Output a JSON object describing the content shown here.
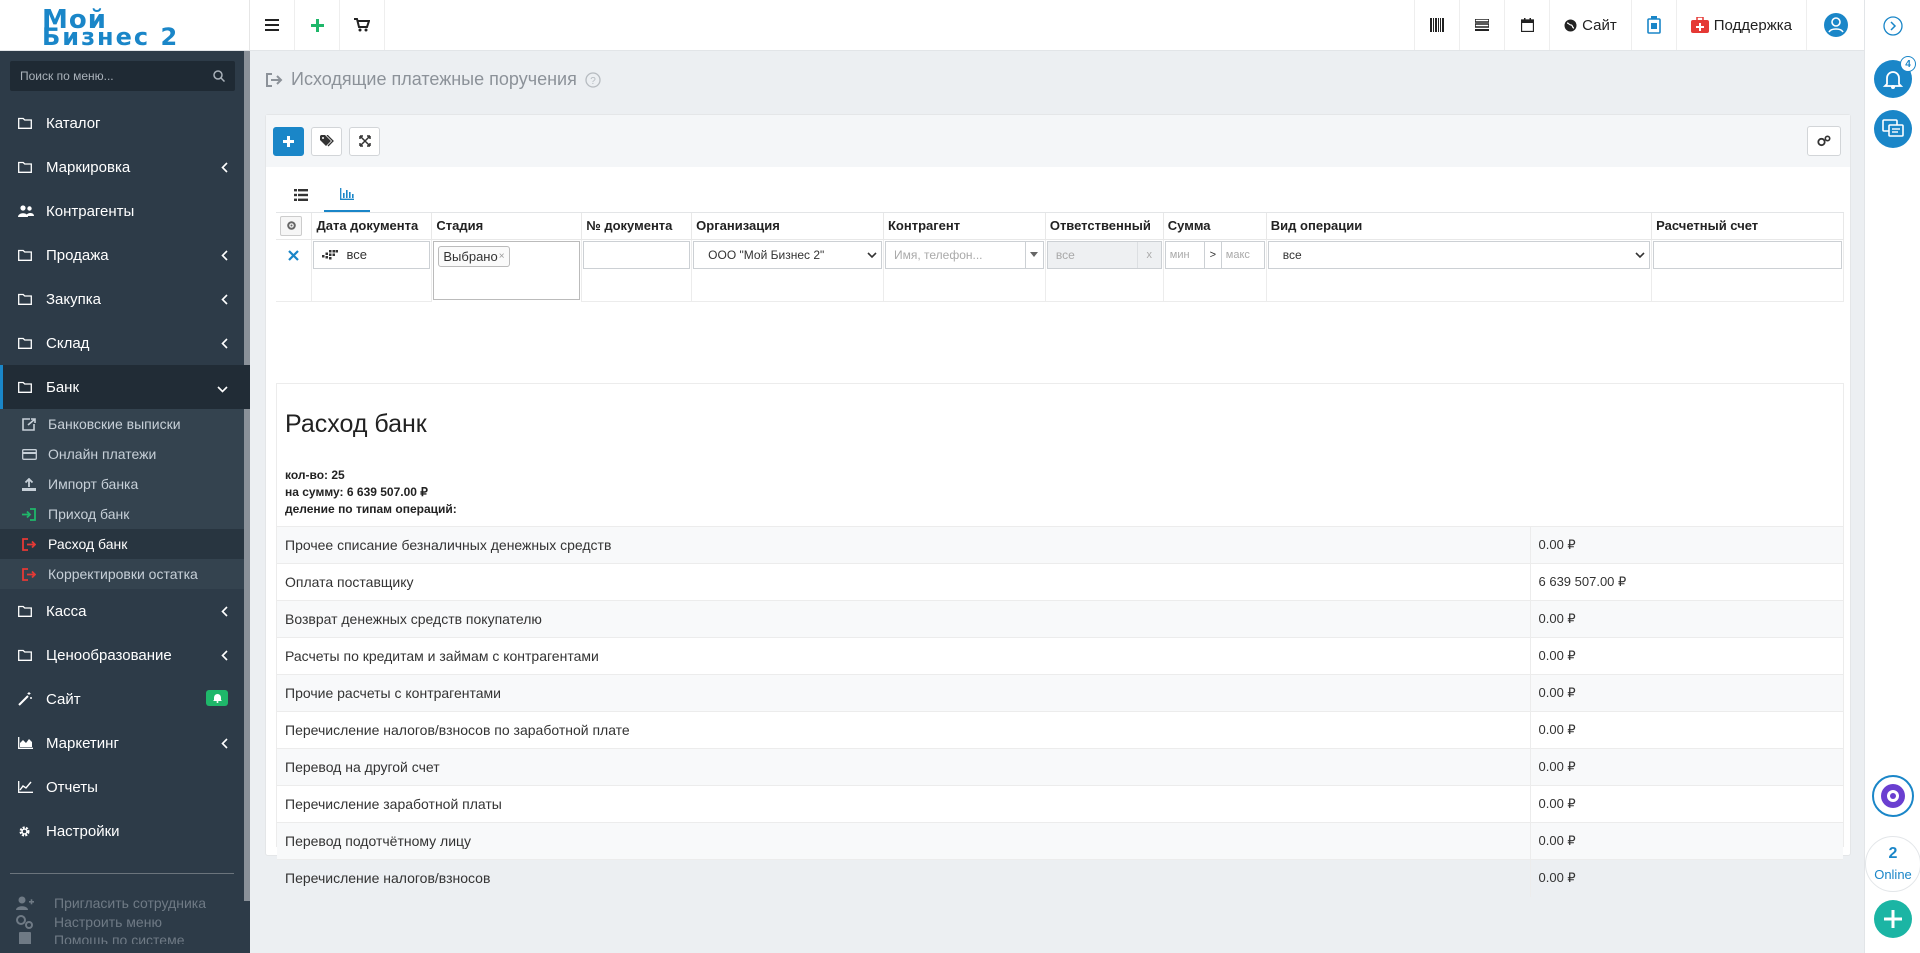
{
  "app": {
    "logo_line1": "Мой",
    "logo_line2": "Бизнес 2"
  },
  "topbar": {
    "site_label": "Сайт",
    "support_label": "Поддержка"
  },
  "rail": {
    "notifications_count": "4",
    "online_count": "2",
    "online_label": "Online"
  },
  "sidebar": {
    "search_placeholder": "Поиск по меню...",
    "items": [
      {
        "label": "Каталог",
        "icon": "folder-icon",
        "chevron": false
      },
      {
        "label": "Маркировка",
        "icon": "folder-icon",
        "chevron": true
      },
      {
        "label": "Контрагенты",
        "icon": "users-icon",
        "chevron": false
      },
      {
        "label": "Продажа",
        "icon": "folder-icon",
        "chevron": true
      },
      {
        "label": "Закупка",
        "icon": "folder-icon",
        "chevron": true
      },
      {
        "label": "Склад",
        "icon": "folder-icon",
        "chevron": true
      },
      {
        "label": "Банк",
        "icon": "folder-icon",
        "chevron": true
      }
    ],
    "bank_submenu": [
      {
        "label": "Банковские выписки",
        "icon": "external-link-icon"
      },
      {
        "label": "Онлайн платежи",
        "icon": "credit-card-icon"
      },
      {
        "label": "Импорт банка",
        "icon": "upload-icon"
      },
      {
        "label": "Приход банк",
        "icon": "sign-in-icon"
      },
      {
        "label": "Расход банк",
        "icon": "sign-out-icon"
      },
      {
        "label": "Корректировки остатка",
        "icon": "sign-out-icon"
      }
    ],
    "items_after": [
      {
        "label": "Касса",
        "icon": "folder-icon",
        "chevron": true
      },
      {
        "label": "Ценообразование",
        "icon": "folder-icon",
        "chevron": true
      },
      {
        "label": "Сайт",
        "icon": "magic-wand-icon",
        "chevron": false
      },
      {
        "label": "Маркетинг",
        "icon": "area-chart-icon",
        "chevron": true
      },
      {
        "label": "Отчеты",
        "icon": "line-chart-icon",
        "chevron": false
      },
      {
        "label": "Настройки",
        "icon": "gear-icon",
        "chevron": false
      }
    ],
    "footer": [
      {
        "label": "Пригласить сотрудника",
        "icon": "user-plus-icon"
      },
      {
        "label": "Настроить меню",
        "icon": "gears-icon"
      },
      {
        "label": "Помощь по системе",
        "icon": "book-icon"
      }
    ]
  },
  "page": {
    "title": "Исходящие платежные поручения"
  },
  "filters": {
    "columns": [
      "Дата документа",
      "Стадия",
      "№ документа",
      "Организация",
      "Контрагент",
      "Ответственный",
      "Сумма",
      "Вид операции",
      "Расчетный счет"
    ],
    "date_value": "все",
    "stage_chip": "Выбрано",
    "organization_value": "ООО \"Мой Бизнес 2\"",
    "counterparty_placeholder": "Имя, телефон...",
    "responsible_value": "все",
    "responsible_clear": "x",
    "sum_min_placeholder": "мин",
    "sum_separator": ">",
    "sum_max_placeholder": "макс",
    "operation_value": "все"
  },
  "report": {
    "title": "Расход банк",
    "count_line": "кол-во: 25",
    "sum_line": "на сумму: 6 639 507.00 ₽",
    "split_line": "деление по типам операций:",
    "rows": [
      {
        "name": "Прочее списание безналичных денежных средств",
        "amount": "0.00 ₽"
      },
      {
        "name": "Оплата поставщику",
        "amount": "6 639 507.00 ₽"
      },
      {
        "name": "Возврат денежных средств покупателю",
        "amount": "0.00 ₽"
      },
      {
        "name": "Расчеты по кредитам и займам с контрагентами",
        "amount": "0.00 ₽"
      },
      {
        "name": "Прочие расчеты с контрагентами",
        "amount": "0.00 ₽"
      },
      {
        "name": "Перечисление налогов/взносов по заработной плате",
        "amount": "0.00 ₽"
      },
      {
        "name": "Перевод на другой счет",
        "amount": "0.00 ₽"
      },
      {
        "name": "Перечисление заработной платы",
        "amount": "0.00 ₽"
      },
      {
        "name": "Перевод подотчётному лицу",
        "amount": "0.00 ₽"
      },
      {
        "name": "Перечисление налогов/взносов",
        "amount": "0.00 ₽"
      }
    ]
  },
  "colors": {
    "accent": "#1a86c8",
    "sidebar_bg": "#2d3b48",
    "support_red": "#e53935",
    "site_badge_green": "#1fb76a"
  }
}
